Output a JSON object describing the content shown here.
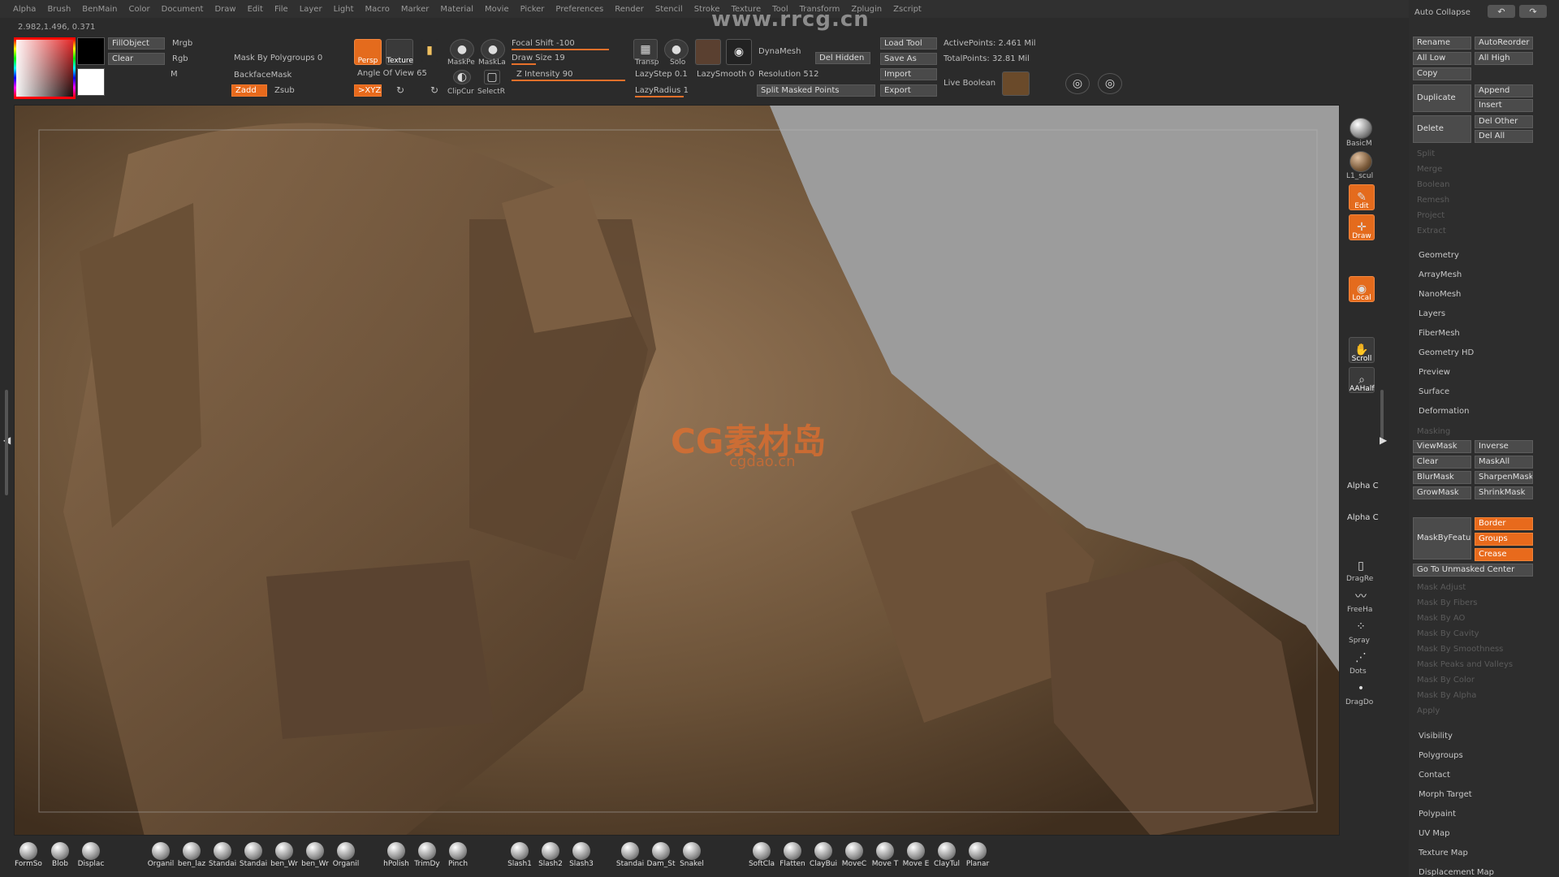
{
  "menu": [
    "Alpha",
    "Brush",
    "BenMain",
    "Color",
    "Document",
    "Draw",
    "Edit",
    "File",
    "Layer",
    "Light",
    "Macro",
    "Marker",
    "Material",
    "Movie",
    "Picker",
    "Preferences",
    "Render",
    "Stencil",
    "Stroke",
    "Texture",
    "Tool",
    "Transform",
    "Zplugin",
    "Zscript"
  ],
  "watermark": "www.rrcg.cn",
  "coords": "2.982,1.496, 0.371",
  "top": {
    "fillobject": "FillObject",
    "mrgb": "Mrgb",
    "clear": "Clear",
    "rgb": "Rgb",
    "m": "M",
    "mask_by_polygroups": "Mask By Polygroups 0",
    "backface_mask": "BackfaceMask",
    "zadd": "Zadd",
    "zsub": "Zsub",
    "persp": "Persp",
    "texture": "Texture",
    "angle_of_view": "Angle Of View 65",
    "sxyz": ">XYZ",
    "maskpe": "MaskPe",
    "maskla": "MaskLa",
    "clipcur": "ClipCur",
    "selectr": "SelectR",
    "focal_shift": "Focal Shift -100",
    "draw_size": "Draw Size 19",
    "z_intensity": "Z Intensity 90",
    "transp": "Transp",
    "solo": "Solo",
    "lazystep": "LazyStep 0.1",
    "lazysmooth": "LazySmooth 0",
    "lazyradius": "LazyRadius 1",
    "dynamesh": "DynaMesh",
    "del_hidden": "Del Hidden",
    "resolution": "Resolution 512",
    "split_masked": "Split Masked Points",
    "load_tool": "Load Tool",
    "save_as": "Save As",
    "import": "Import",
    "export": "Export",
    "active_points": "ActivePoints: 2.461 Mil",
    "total_points": "TotalPoints: 32.81 Mil",
    "live_boolean": "Live Boolean"
  },
  "dock": {
    "basicm": "BasicM",
    "l1": "L1_scul",
    "edit": "Edit",
    "draw": "Draw",
    "local": "Local",
    "scroll": "Scroll",
    "aahalf": "AAHalf",
    "alpha1": "Alpha C",
    "alpha2": "Alpha C",
    "dragre": "DragRe",
    "freeha": "FreeHa",
    "spray": "Spray",
    "dots": "Dots",
    "dragdo": "DragDo"
  },
  "panel": {
    "auto_collapse": "Auto Collapse",
    "rename": "Rename",
    "autoreorder": "AutoReorder",
    "all_low": "All Low",
    "all_high": "All High",
    "copy": "Copy",
    "duplicate": "Duplicate",
    "append": "Append",
    "insert": "Insert",
    "delete": "Delete",
    "del_other": "Del Other",
    "del_all": "Del All",
    "dim1": [
      "Split",
      "Merge",
      "Boolean",
      "Remesh",
      "Project",
      "Extract"
    ],
    "sections1": [
      "Geometry",
      "ArrayMesh",
      "NanoMesh",
      "Layers",
      "FiberMesh",
      "Geometry HD",
      "Preview",
      "Surface",
      "Deformation"
    ],
    "masking": "Masking",
    "viewmask": "ViewMask",
    "inverse": "Inverse",
    "clear": "Clear",
    "maskall": "MaskAll",
    "blurmask": "BlurMask",
    "sharpenmask": "SharpenMask",
    "growmask": "GrowMask",
    "shrinkmask": "ShrinkMask",
    "maskbyfeature": "MaskByFeature",
    "border": "Border",
    "groups": "Groups",
    "crease": "Crease",
    "go_unmasked": "Go To Unmasked Center",
    "dim2": [
      "Mask Adjust",
      "Mask By Fibers",
      "Mask By AO",
      "Mask By Cavity",
      "Mask By Smoothness",
      "Mask Peaks and Valleys",
      "Mask By Color",
      "Mask By Alpha",
      "Apply"
    ],
    "sections2": [
      "Visibility",
      "Polygroups",
      "Contact",
      "Morph Target",
      "Polypaint",
      "UV Map",
      "Texture Map",
      "Displacement Map"
    ]
  },
  "center_logo": "CG素材岛",
  "center_logo_sub": "cgdao.cn",
  "brushes": [
    "FormSo",
    "Blob",
    "Displac",
    "Organil",
    "ben_laz",
    "Standai",
    "Standai",
    "ben_Wr",
    "ben_Wr",
    "Organil",
    "hPolish",
    "TrimDy",
    "Pinch",
    "Slash1",
    "Slash2",
    "Slash3",
    "Standai",
    "Dam_St",
    "Snakel",
    "SoftCla",
    "Flatten",
    "ClayBui",
    "MoveC",
    "Move T",
    "Move E",
    "ClayTul",
    "Planar"
  ],
  "colors": {
    "accent": "#e86a1c",
    "panel": "#2d2d2d",
    "button": "#4a4a4a"
  }
}
